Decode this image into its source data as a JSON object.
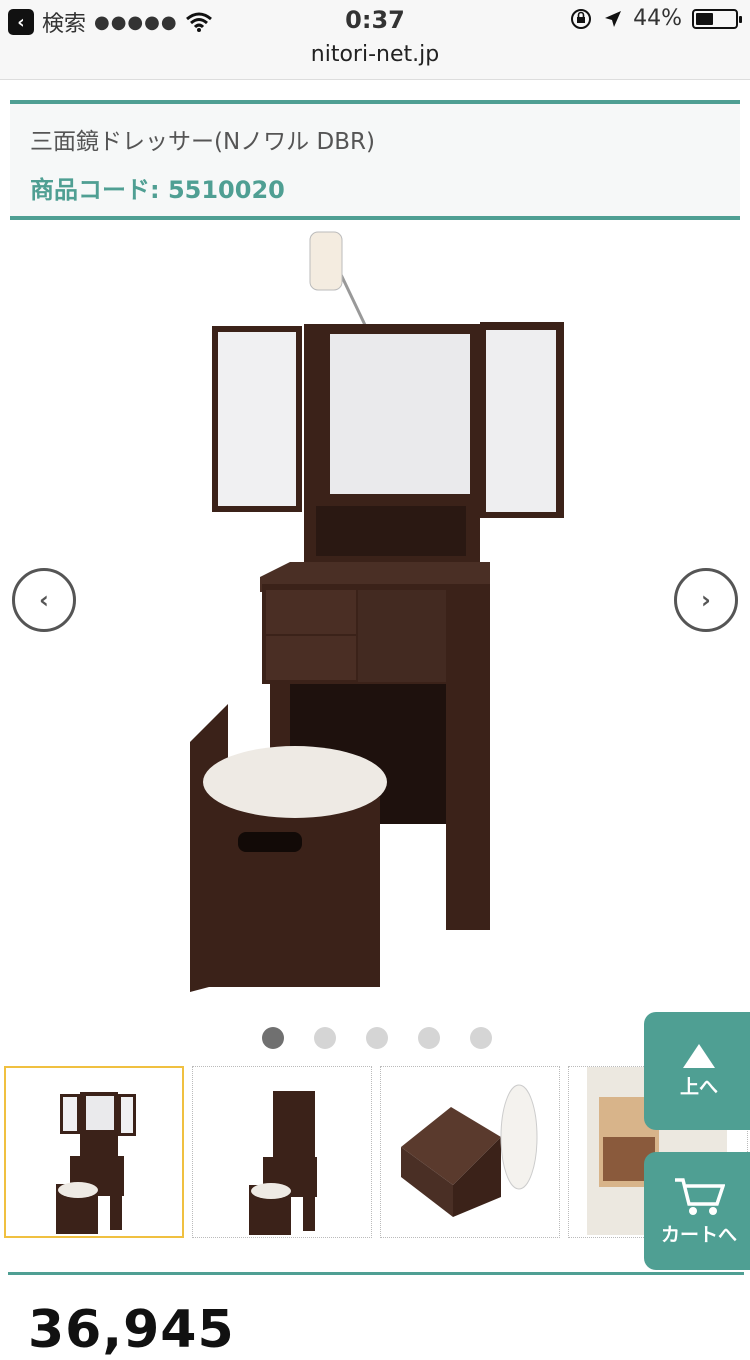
{
  "status": {
    "back_label": "検索",
    "signal": "●●●●●",
    "time": "0:37",
    "battery_percent": "44%",
    "battery_level": 0.44
  },
  "browser": {
    "url": "nitori-net.jp"
  },
  "product": {
    "name": "三面鏡ドレッサー(Nノワル DBR)",
    "code": "商品コード: 5510020",
    "price": "36,945"
  },
  "gallery": {
    "active_index": 0,
    "dot_count": 5,
    "thumbs": [
      "thumb-dresser-open",
      "thumb-dresser-closed",
      "thumb-stool-storage",
      "thumb-drawer-detail"
    ]
  },
  "floating": {
    "top_label": "上へ",
    "cart_label": "カートへ"
  },
  "colors": {
    "accent": "#4f9f93",
    "wood": "#3b2219",
    "selected_border": "#f0c040"
  },
  "icons": [
    "back-icon",
    "wifi-icon",
    "lock-rotation-icon",
    "location-icon",
    "battery-icon",
    "chevron-left-icon",
    "chevron-right-icon",
    "up-arrow-icon",
    "cart-icon"
  ]
}
